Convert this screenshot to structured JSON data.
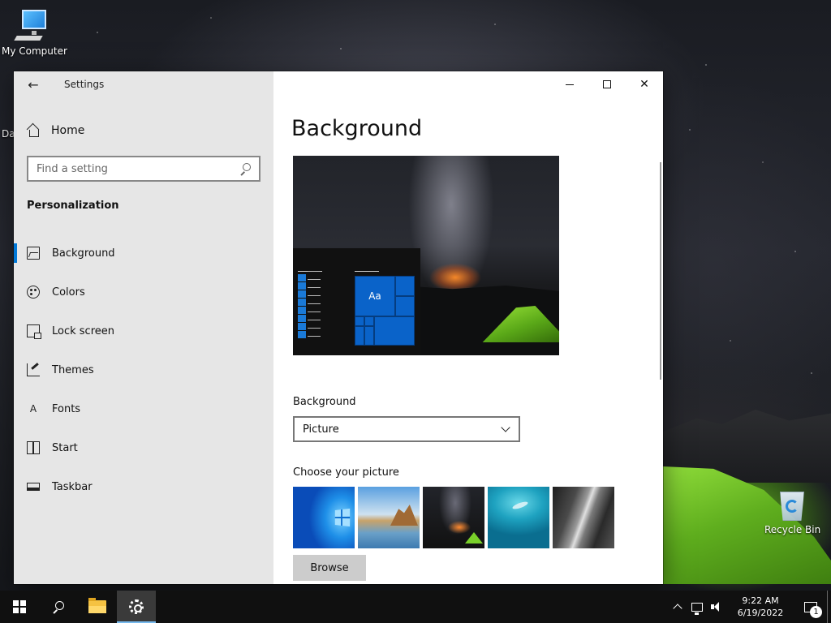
{
  "desktop": {
    "icons": [
      {
        "label": "My Computer",
        "icon": "computer-icon"
      },
      {
        "label": "Recycle Bin",
        "icon": "recycle-bin-icon"
      }
    ],
    "partial_label": "Da"
  },
  "window": {
    "app_title": "Settings",
    "back_icon": "back-arrow-icon",
    "controls": {
      "minimize": "minimize-icon",
      "maximize": "maximize-icon",
      "close": "close-icon",
      "close_glyph": "✕"
    }
  },
  "sidebar": {
    "home_label": "Home",
    "search_placeholder": "Find a setting",
    "section_title": "Personalization",
    "items": [
      {
        "label": "Background",
        "icon": "picture-icon",
        "active": true
      },
      {
        "label": "Colors",
        "icon": "palette-icon",
        "active": false
      },
      {
        "label": "Lock screen",
        "icon": "lock-screen-icon",
        "active": false
      },
      {
        "label": "Themes",
        "icon": "themes-icon",
        "active": false
      },
      {
        "label": "Fonts",
        "icon": "fonts-icon",
        "glyph": "A",
        "active": false
      },
      {
        "label": "Start",
        "icon": "start-icon",
        "active": false
      },
      {
        "label": "Taskbar",
        "icon": "taskbar-icon",
        "active": false
      }
    ]
  },
  "main": {
    "title": "Background",
    "preview_tile_label": "Aa",
    "background_label": "Background",
    "background_value": "Picture",
    "choose_label": "Choose your picture",
    "thumbnails": [
      "windows-light",
      "beach-rocks",
      "milky-way-tent",
      "underwater-swimmer",
      "rock-cliff"
    ],
    "browse_label": "Browse"
  },
  "taskbar": {
    "apps": [
      "start-icon",
      "search-icon",
      "file-explorer-icon",
      "settings-icon"
    ],
    "clock_time": "9:22 AM",
    "clock_date": "6/19/2022",
    "notification_count": "1"
  },
  "colors": {
    "accent": "#0078d7",
    "sidebar_bg": "#e6e6e6",
    "taskbar_bg": "#101010"
  }
}
